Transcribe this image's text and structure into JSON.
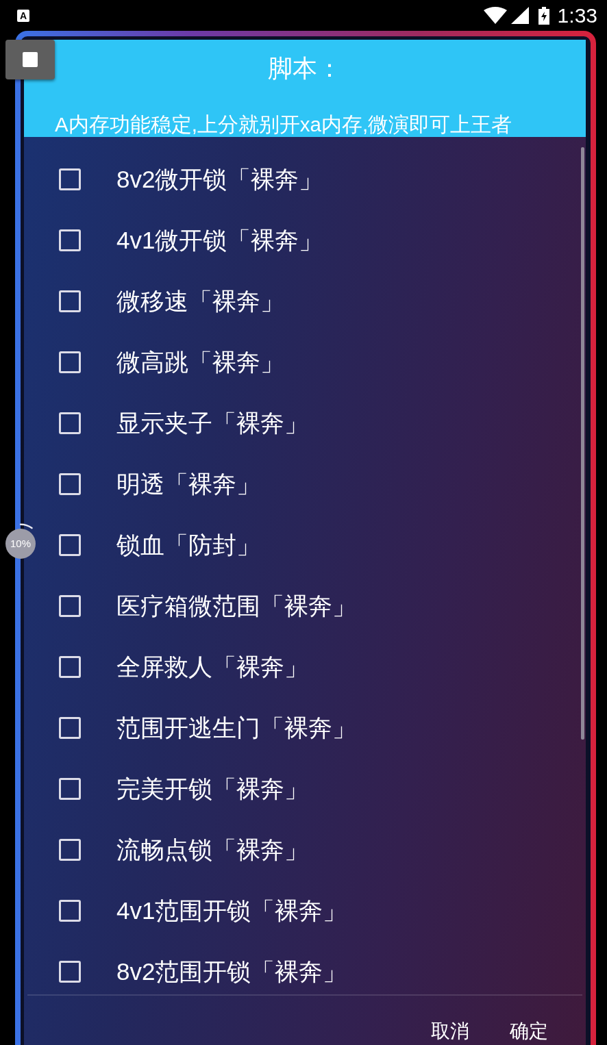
{
  "status_bar": {
    "notification_icon": "A",
    "time": "1:33"
  },
  "progress_badge": {
    "text": "10%"
  },
  "dialog": {
    "title": "脚本：",
    "message": "A内存功能稳定,上分就别开xa内存,微演即可上王者",
    "options": [
      {
        "label": "8v2微开锁「裸奔」",
        "checked": false
      },
      {
        "label": "4v1微开锁「裸奔」",
        "checked": false
      },
      {
        "label": "微移速「裸奔」",
        "checked": false
      },
      {
        "label": "微高跳「裸奔」",
        "checked": false
      },
      {
        "label": "显示夹子「裸奔」",
        "checked": false
      },
      {
        "label": "明透「裸奔」",
        "checked": false
      },
      {
        "label": "锁血「防封」",
        "checked": false
      },
      {
        "label": "医疗箱微范围「裸奔」",
        "checked": false
      },
      {
        "label": "全屏救人「裸奔」",
        "checked": false
      },
      {
        "label": "范围开逃生门「裸奔」",
        "checked": false
      },
      {
        "label": "完美开锁「裸奔」",
        "checked": false
      },
      {
        "label": "流畅点锁「裸奔」",
        "checked": false
      },
      {
        "label": "4v1范围开锁「裸奔」",
        "checked": false
      },
      {
        "label": "8v2范围开锁「裸奔」",
        "checked": false
      }
    ],
    "buttons": [
      "取消",
      "确定"
    ]
  }
}
